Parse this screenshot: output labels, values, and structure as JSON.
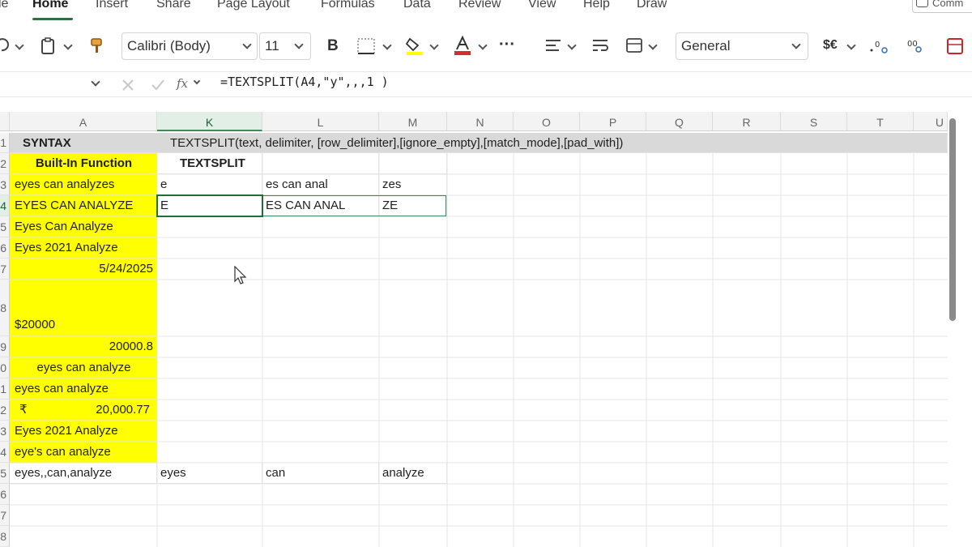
{
  "ribbon": {
    "tabs": [
      "le",
      "Home",
      "Insert",
      "Share",
      "Page Layout",
      "Formulas",
      "Data",
      "Review",
      "View",
      "Help",
      "Draw"
    ],
    "active_tab": "Home",
    "comments_label": "Comm"
  },
  "toolbar": {
    "font_name": "Calibri (Body)",
    "font_size": "11",
    "bold_label": "B",
    "number_format": "General",
    "currency_label": "$€",
    "more_label": "···"
  },
  "formula_bar": {
    "fx_label": "fx",
    "formula": "=TEXTSPLIT(A4,\"y\",,,1 )"
  },
  "columns": [
    "A",
    "K",
    "L",
    "M",
    "N",
    "O",
    "P",
    "Q",
    "R",
    "S",
    "T",
    "U"
  ],
  "row_numbers": [
    "1",
    "2",
    "3",
    "4",
    "5",
    "6",
    "7",
    "8",
    "9",
    "0",
    "1",
    "2",
    "3",
    "4",
    "5",
    "6",
    "7",
    "8"
  ],
  "cells": {
    "r1": {
      "a": "SYNTAX",
      "k": "TEXTSPLIT(text, delimiter, [row_delimiter],[ignore_empty],[match_mode],[pad_with])"
    },
    "r2": {
      "a": "Built-In Function",
      "k": "TEXTSPLIT"
    },
    "r3": {
      "a": "eyes can analyzes",
      "k": "e",
      "l": "es can anal",
      "m": "zes"
    },
    "r4": {
      "a": "EYES CAN ANALYZE",
      "k": "E",
      "l": "ES CAN ANAL",
      "m": "ZE"
    },
    "r5": {
      "a": "Eyes Can Analyze"
    },
    "r6": {
      "a": "Eyes 2021 Analyze"
    },
    "r7": {
      "a": "5/24/2025"
    },
    "r8": {
      "a": "$20000"
    },
    "r9": {
      "a": "20000.8"
    },
    "r10": {
      "a": "eyes can analyze"
    },
    "r11": {
      "a": "eyes can analyze"
    },
    "r12": {
      "a_symbol": "₹",
      "a": "20,000.77"
    },
    "r13": {
      "a": "Eyes 2021 Analyze"
    },
    "r14": {
      "a": "eye's can analyze"
    },
    "r15": {
      "a": "eyes,,can,analyze",
      "k": "eyes",
      "l": "can",
      "m": "analyze"
    }
  },
  "colors": {
    "highlight": "#ffff00",
    "header_row": "#d9d9d9",
    "selection": "#1e6e3a"
  }
}
